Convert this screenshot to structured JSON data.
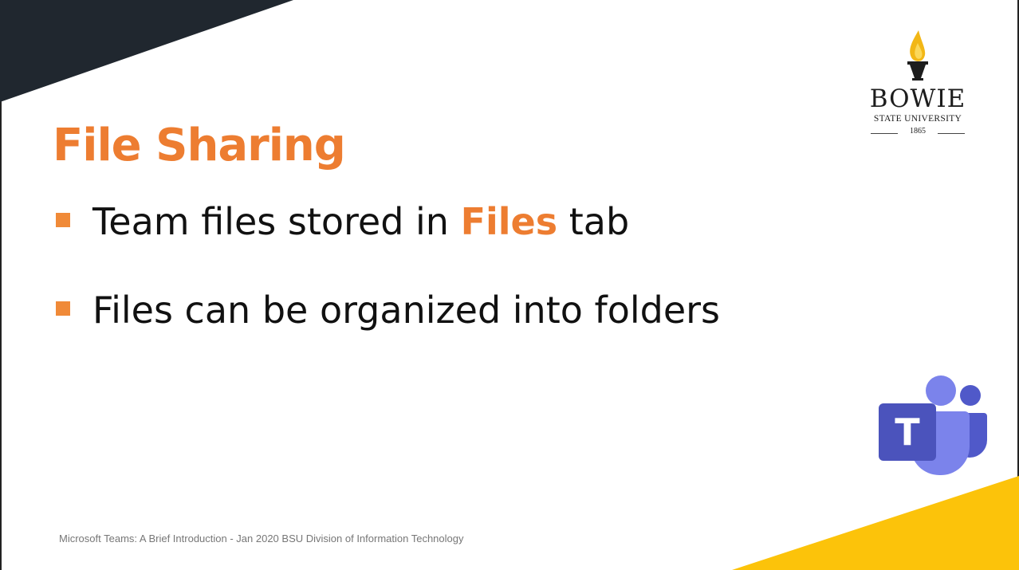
{
  "slide": {
    "title": "File Sharing",
    "bullets": [
      {
        "before": "Team files stored in ",
        "highlight": "Files",
        "after": " tab"
      },
      {
        "before": "Files can be organized into folders"
      }
    ],
    "footer": "Microsoft Teams: A Brief Introduction - Jan 2020 BSU Division of Information Technology"
  },
  "logo": {
    "name": "BOWIE",
    "subtitle": "STATE UNIVERSITY",
    "year": "1865",
    "icon": "torch-icon"
  },
  "teams_logo": {
    "letter": "T",
    "icon": "microsoft-teams-icon"
  },
  "colors": {
    "accent": "#ed7d31",
    "dark_corner": "#20272f",
    "gold_corner": "#fcc30a",
    "teams_purple": "#5059c9",
    "teams_light": "#7b83eb"
  }
}
